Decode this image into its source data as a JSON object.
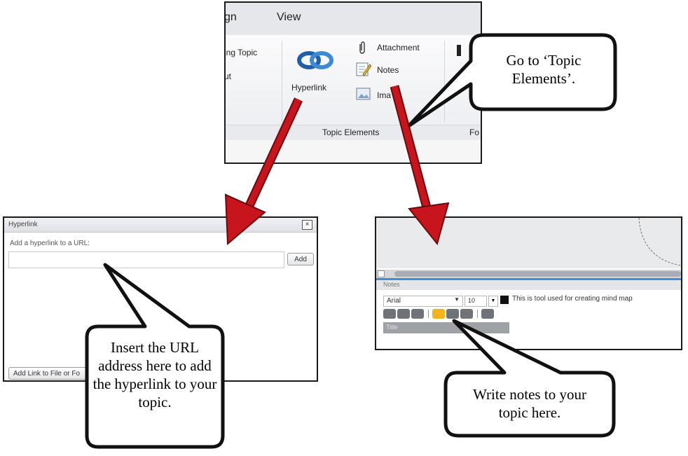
{
  "ribbon": {
    "tabs": [
      "gn",
      "View"
    ],
    "left_items": [
      "ing Topic",
      "ut"
    ],
    "hyperlink_label": "Hyperlink",
    "attachment_label": "Attachment",
    "notes_label": "Notes",
    "image_label": "Ima  e",
    "group_label": "Topic Elements",
    "next_group_label": "Fo"
  },
  "hyperlink_dialog": {
    "title": "Hyperlink",
    "close_glyph": "×",
    "prompt": "Add a hyperlink to a URL:",
    "url_value": "",
    "add_button": "Add",
    "file_button": "Add Link to File or Fo"
  },
  "notes_panel": {
    "header": "Notes",
    "font_name": "Arial",
    "font_size": "10",
    "note_text": "This is tool used for creating mind map",
    "placeholder": "Title"
  },
  "callouts": {
    "topic_elements": [
      "Go to ‘Topic",
      "Elements’."
    ],
    "url": [
      "Insert the URL",
      "address here to add",
      "the hyperlink to your",
      "topic."
    ],
    "notes": [
      "Write notes to your",
      "topic here."
    ]
  },
  "colors": {
    "arrow": "#c8141c",
    "arrow_dark": "#6b0a0e",
    "accent_orange": "#f5b31e",
    "scroll_blue": "#3d8fd8"
  }
}
